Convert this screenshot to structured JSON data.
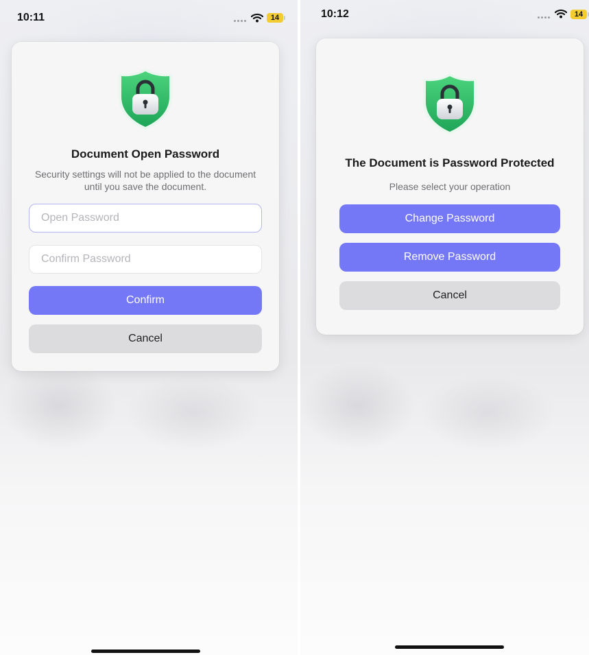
{
  "left_screen": {
    "status_bar": {
      "time": "10:11",
      "battery_level": "14",
      "signal_icon": "signal-dots-icon",
      "wifi_icon": "wifi-icon"
    },
    "dialog": {
      "icon": "shield-lock-icon",
      "title": "Document Open Password",
      "message": "Security settings will not be applied to the document until you save the document.",
      "open_password": {
        "value": "",
        "placeholder": "Open Password"
      },
      "confirm_password": {
        "value": "",
        "placeholder": "Confirm Password"
      },
      "confirm_label": "Confirm",
      "cancel_label": "Cancel"
    }
  },
  "right_screen": {
    "status_bar": {
      "time": "10:12",
      "battery_level": "14",
      "signal_icon": "signal-dots-icon",
      "wifi_icon": "wifi-icon"
    },
    "dialog": {
      "icon": "shield-lock-icon",
      "title": "The Document is Password Protected",
      "message": "Please select your operation",
      "change_label": "Change Password",
      "remove_label": "Remove Password",
      "cancel_label": "Cancel"
    }
  },
  "colors": {
    "accent": "#7478F6",
    "secondary_button": "#DCDCDE",
    "shield_green": "#34C46A",
    "battery": "#F2CC30"
  }
}
